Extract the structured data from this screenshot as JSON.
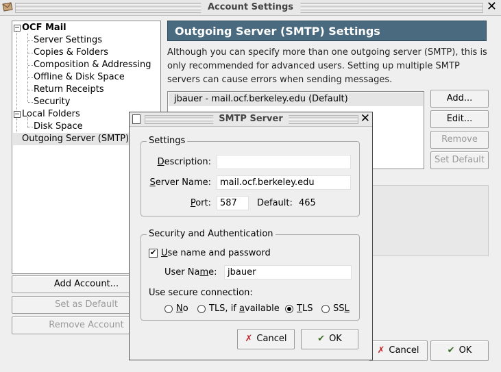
{
  "window": {
    "title": "Account Settings"
  },
  "tree": {
    "accounts": [
      {
        "name": "OCF Mail",
        "items": [
          "Server Settings",
          "Copies & Folders",
          "Composition & Addressing",
          "Offline & Disk Space",
          "Return Receipts",
          "Security"
        ]
      },
      {
        "name": "Local Folders",
        "items": [
          "Disk Space"
        ]
      }
    ],
    "outgoing": "Outgoing Server (SMTP)"
  },
  "left_buttons": {
    "add_account": "Add Account...",
    "set_default": "Set as Default",
    "remove_account": "Remove Account"
  },
  "smtp_page": {
    "header": "Outgoing Server (SMTP) Settings",
    "description_lines": [
      "Although you can specify more than one outgoing server (SMTP), this is",
      "only recommended for advanced users. Setting up multiple SMTP",
      "servers can cause errors when sending messages."
    ],
    "servers": [
      "jbauer - mail.ocf.berkeley.edu (Default)"
    ],
    "buttons": {
      "add": "Add...",
      "edit": "Edit...",
      "remove": "Remove",
      "set_default": "Set Default"
    }
  },
  "main_buttons": {
    "cancel": "Cancel",
    "ok": "OK"
  },
  "dialog": {
    "title": "SMTP Server",
    "settings_group": "Settings",
    "description_label": "Description:",
    "description_value": "",
    "server_name_label": "Server Name:",
    "server_name_value": "mail.ocf.berkeley.edu",
    "port_label": "Port:",
    "port_value": "587",
    "default_label": "Default:",
    "default_value": "465",
    "security_group": "Security and Authentication",
    "use_name_password": "Use name and password",
    "use_name_password_checked": true,
    "user_name_label": "User Name:",
    "user_name_value": "jbauer",
    "secure_conn_label": "Use secure connection:",
    "radio_options": [
      "No",
      "TLS, if available",
      "TLS",
      "SSL"
    ],
    "radio_selected": "TLS",
    "cancel": "Cancel",
    "ok": "OK"
  }
}
